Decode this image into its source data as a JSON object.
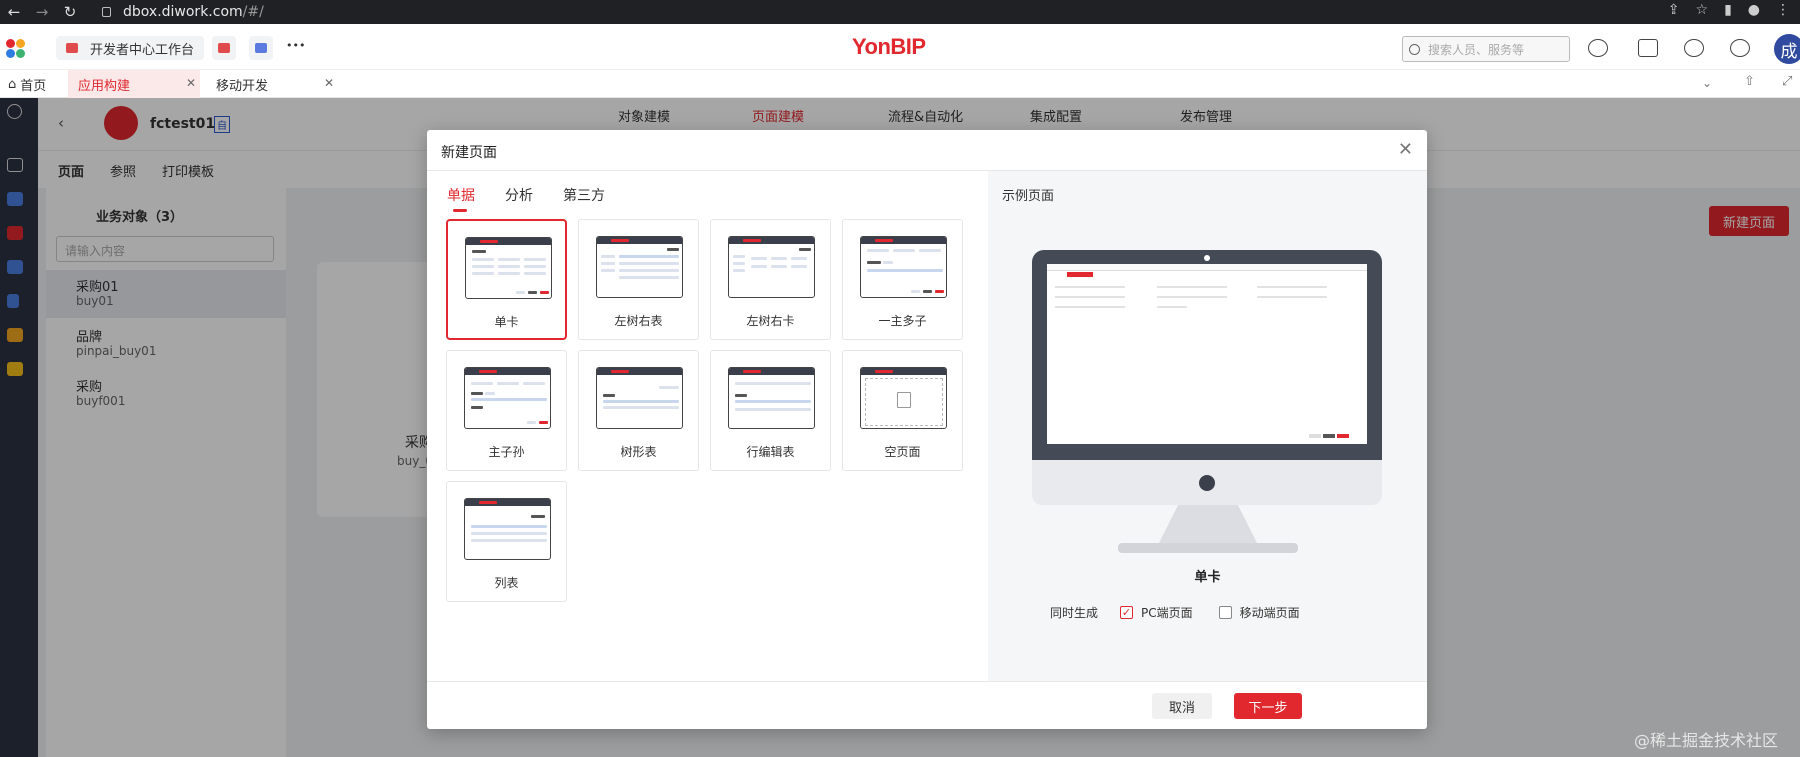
{
  "browser": {
    "url_host": "dbox.diwork.com",
    "url_path": "/#/"
  },
  "app": {
    "brand": "YonBIP",
    "workspace_tab": "开发者中心工作台",
    "search_placeholder": "搜索人员、服务等",
    "avatar_text": "成",
    "more": "•••"
  },
  "tabs": [
    {
      "label": "首页"
    },
    {
      "label": "应用构建"
    },
    {
      "label": "移动开发"
    }
  ],
  "background": {
    "app_name": "fctest01",
    "app_badge": "自",
    "top_nav": [
      "对象建模",
      "页面建模",
      "流程&自动化",
      "集成配置",
      "发布管理"
    ],
    "sub_tabs": [
      "页面",
      "参照",
      "打印模板"
    ],
    "objects_title": "业务对象（3）",
    "filter_placeholder": "请输入内容",
    "objects": [
      {
        "name": "采购01",
        "code": "buy01"
      },
      {
        "name": "品牌",
        "code": "pinpai_buy01"
      },
      {
        "name": "采购",
        "code": "buyf001"
      }
    ],
    "card_title": "采购",
    "card_code": "buy_0",
    "new_page_button": "新建页面"
  },
  "modal": {
    "title": "新建页面",
    "close": "✕",
    "tabs": [
      "单据",
      "分析",
      "第三方"
    ],
    "templates": [
      {
        "label": "单卡"
      },
      {
        "label": "左树右表"
      },
      {
        "label": "左树右卡"
      },
      {
        "label": "一主多子"
      },
      {
        "label": "主子孙"
      },
      {
        "label": "树形表"
      },
      {
        "label": "行编辑表"
      },
      {
        "label": "空页面"
      },
      {
        "label": "列表"
      }
    ],
    "selected_template_index": 0,
    "preview_title": "示例页面",
    "preview_name": "单卡",
    "generate_label": "同时生成",
    "pc_label": "PC端页面",
    "pc_checked": true,
    "mobile_label": "移动端页面",
    "mobile_checked": false,
    "cancel": "取消",
    "next": "下一步"
  },
  "watermark": "@稀土掘金技术社区",
  "colors": {
    "accent": "#e0282e",
    "rail": "#2b3242"
  }
}
